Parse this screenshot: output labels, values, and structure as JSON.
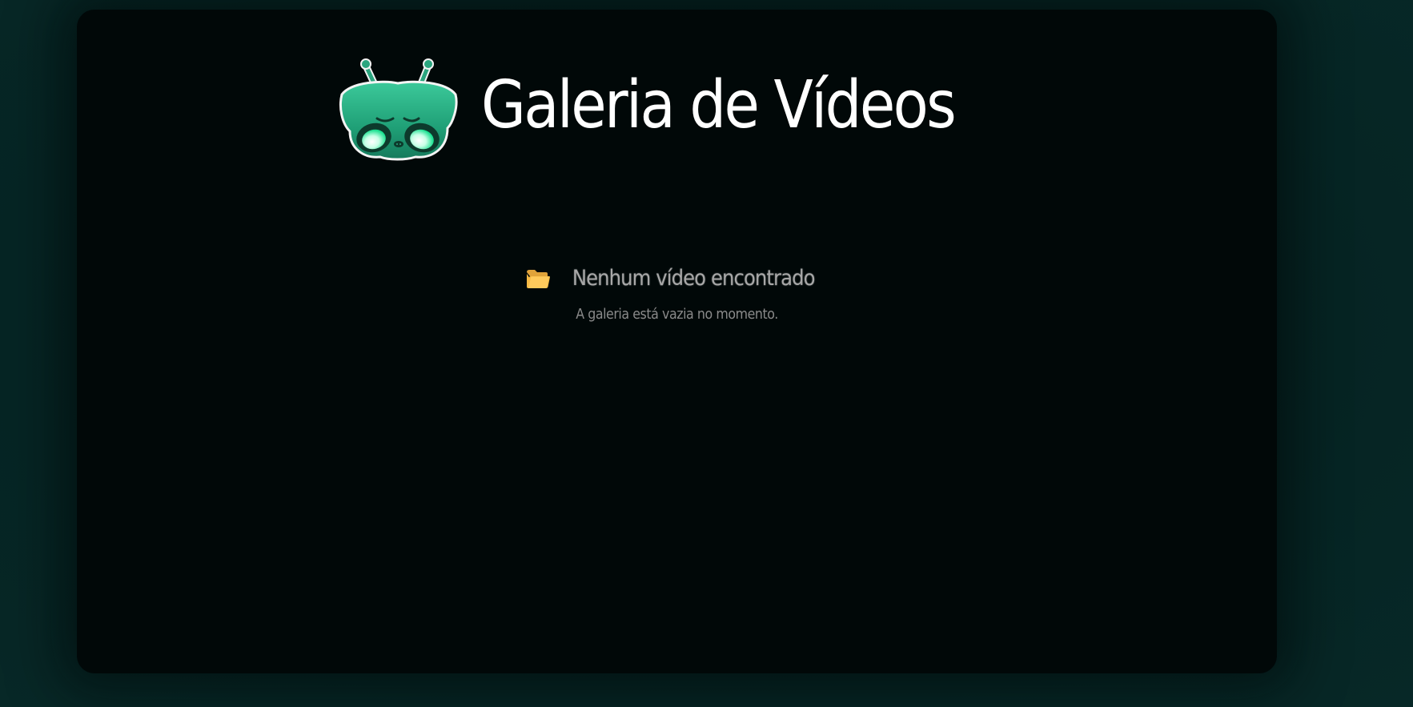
{
  "header": {
    "title": "Galeria de Vídeos",
    "logo_icon": "alien-mascot-icon"
  },
  "empty_state": {
    "icon": "open-folder-icon",
    "heading": "Nenhum vídeo encontrado",
    "message": "A galeria está vazia no momento."
  },
  "colors": {
    "background": "#062423",
    "panel": "#010808",
    "title": "#ffffff",
    "heading": "#a8a8a8",
    "message": "#8a8a8a",
    "accent_green": "#2bb88a",
    "folder": "#f7b944"
  }
}
